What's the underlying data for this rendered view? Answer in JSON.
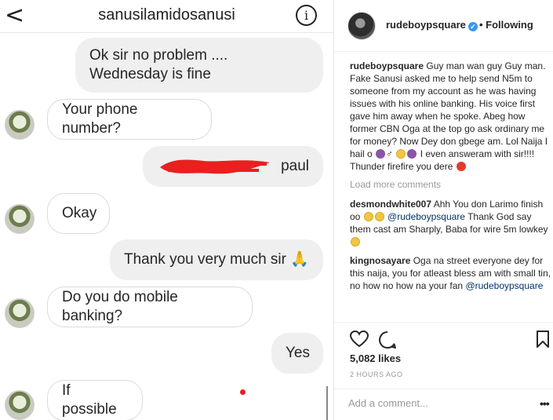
{
  "dm": {
    "back_icon": "chevron-left-icon",
    "title": "sanusilamidosanusi",
    "info_icon": "info-icon",
    "info_glyph": "i",
    "messages": [
      {
        "text": "Ok sir no problem .... Wednesday is fine",
        "side": "out"
      },
      {
        "text": "Your phone number?",
        "side": "in"
      },
      {
        "text": "paul",
        "side": "out"
      },
      {
        "text": "Okay",
        "side": "in"
      },
      {
        "text": "Thank you very much sir 🙏",
        "side": "out"
      },
      {
        "text": "Do you do mobile banking?",
        "side": "in"
      },
      {
        "text": "Yes",
        "side": "out"
      },
      {
        "text": "If possible",
        "side": "in"
      }
    ]
  },
  "ig": {
    "username": "rudeboypsquare",
    "verified_glyph": "✓",
    "following": "• Following",
    "caption": {
      "user": "rudeboypsquare",
      "text_1": "Guy man wan guy Guy man. Fake Sanusi asked me to help send N5m to someone from my account as he was having issues with his online banking. His voice first gave him away when he spoke. Abeg how former CBN Oga at the top go ask ordinary me for money? Now Dey don gbege am. Lol Naija I hail o",
      "text_2": "I even answeram with sir!!!! Thunder firefire you dere"
    },
    "load_more": "Load more comments",
    "comments": [
      {
        "user": "desmondwhite007",
        "text_1": "Ahh You don Larimo finish oo",
        "mention": "@rudeboypsquare",
        "text_2": "Thank God say them cast am Sharply, Baba for wire 5m lowkey"
      },
      {
        "user": "kingnosayare",
        "text_1": "Oga na street everyone dey for this naija, you for atleast bless am with small tin, no how no how na your fan",
        "mention": "@rudeboypsquare",
        "text_2": ""
      }
    ],
    "likes": "5,082 likes",
    "time_ago": "2 HOURS AGO",
    "add_comment_placeholder": "Add a comment...",
    "more_glyph": "•••"
  },
  "colors": {
    "redaction": "#e8201f",
    "verified": "#3897f0",
    "mention": "#003569",
    "bubble_out": "#efefef"
  }
}
